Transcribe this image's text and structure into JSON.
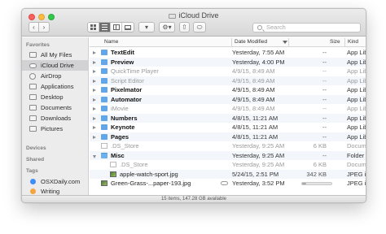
{
  "window": {
    "title": "iCloud Drive",
    "status": "15 items, 147.28 GB available"
  },
  "toolbar": {
    "back_glyph": "‹",
    "forward_glyph": "›",
    "views": [
      "icon-view",
      "list-view",
      "column-view",
      "cover-flow-view"
    ],
    "active_view": "list-view",
    "arrange_glyph": "▾",
    "action_glyph": "⚙▾",
    "share_glyph": "⇧",
    "tag_glyph": "⬭",
    "search_placeholder": "Search"
  },
  "sidebar": {
    "favorites_heading": "Favorites",
    "favorites": [
      {
        "label": "All My Files",
        "icon": "all-files-icon",
        "selected": false
      },
      {
        "label": "iCloud Drive",
        "icon": "icloud-icon",
        "selected": true
      },
      {
        "label": "AirDrop",
        "icon": "airdrop-icon",
        "selected": false
      },
      {
        "label": "Applications",
        "icon": "applications-icon",
        "selected": false
      },
      {
        "label": "Desktop",
        "icon": "desktop-icon",
        "selected": false
      },
      {
        "label": "Documents",
        "icon": "documents-icon",
        "selected": false
      },
      {
        "label": "Downloads",
        "icon": "downloads-icon",
        "selected": false
      },
      {
        "label": "Pictures",
        "icon": "pictures-icon",
        "selected": false
      }
    ],
    "devices_heading": "Devices",
    "shared_heading": "Shared",
    "tags_heading": "Tags",
    "tags": [
      {
        "label": "OSXDaily.com",
        "color": "#3e8ef7"
      },
      {
        "label": "Writing",
        "color": "#f6a440"
      }
    ]
  },
  "columns": {
    "name": "Name",
    "date": "Date Modified",
    "size": "Size",
    "kind": "Kind"
  },
  "rows": [
    {
      "name": "TextEdit",
      "date": "Yesterday, 7:55 AM",
      "size": "--",
      "kind": "App Library",
      "icon": "app",
      "disclosure": "closed",
      "indent": 0,
      "dim": false
    },
    {
      "name": "Preview",
      "date": "Yesterday, 4:00 PM",
      "size": "--",
      "kind": "App Library",
      "icon": "app",
      "disclosure": "closed",
      "indent": 0,
      "dim": false
    },
    {
      "name": "QuickTime Player",
      "date": "4/9/15, 8:49 AM",
      "size": "--",
      "kind": "App Library",
      "icon": "app",
      "disclosure": "closed",
      "indent": 0,
      "dim": true
    },
    {
      "name": "Script Editor",
      "date": "4/9/15, 8:49 AM",
      "size": "--",
      "kind": "App Library",
      "icon": "app",
      "disclosure": "closed",
      "indent": 0,
      "dim": true
    },
    {
      "name": "Pixelmator",
      "date": "4/9/15, 8:49 AM",
      "size": "--",
      "kind": "App Library",
      "icon": "app",
      "disclosure": "closed",
      "indent": 0,
      "dim": false
    },
    {
      "name": "Automator",
      "date": "4/9/15, 8:49 AM",
      "size": "--",
      "kind": "App Library",
      "icon": "app",
      "disclosure": "closed",
      "indent": 0,
      "dim": false
    },
    {
      "name": "iMovie",
      "date": "4/9/15, 8:49 AM",
      "size": "--",
      "kind": "App Library",
      "icon": "app",
      "disclosure": "closed",
      "indent": 0,
      "dim": true
    },
    {
      "name": "Numbers",
      "date": "4/8/15, 11:21 AM",
      "size": "--",
      "kind": "App Library",
      "icon": "app",
      "disclosure": "closed",
      "indent": 0,
      "dim": false
    },
    {
      "name": "Keynote",
      "date": "4/8/15, 11:21 AM",
      "size": "--",
      "kind": "App Library",
      "icon": "app",
      "disclosure": "closed",
      "indent": 0,
      "dim": false
    },
    {
      "name": "Pages",
      "date": "4/8/15, 11:21 AM",
      "size": "--",
      "kind": "App Library",
      "icon": "app",
      "disclosure": "closed",
      "indent": 0,
      "dim": false
    },
    {
      "name": ".DS_Store",
      "date": "Yesterday, 9:25 AM",
      "size": "6 KB",
      "kind": "Document",
      "icon": "doc",
      "disclosure": "none",
      "indent": 0,
      "dim": true
    },
    {
      "name": "Misc",
      "date": "Yesterday, 9:25 AM",
      "size": "--",
      "kind": "Folder",
      "icon": "folder",
      "disclosure": "open",
      "indent": 0,
      "dim": false
    },
    {
      "name": ".DS_Store",
      "date": "Yesterday, 9:25 AM",
      "size": "6 KB",
      "kind": "Document",
      "icon": "doc",
      "disclosure": "none",
      "indent": 1,
      "dim": true
    },
    {
      "name": "apple-watch-sport.jpg",
      "date": "5/24/15, 2:51 PM",
      "size": "342 KB",
      "kind": "JPEG image",
      "icon": "img",
      "disclosure": "none",
      "indent": 1,
      "dim": false
    },
    {
      "name": "Green-Grass-...paper-193.jpg",
      "date": "Yesterday, 3:52 PM",
      "size": "",
      "kind": "JPEG image",
      "icon": "img",
      "disclosure": "none",
      "indent": 0,
      "dim": false,
      "cloud": true,
      "download_progress": 0.15
    }
  ]
}
